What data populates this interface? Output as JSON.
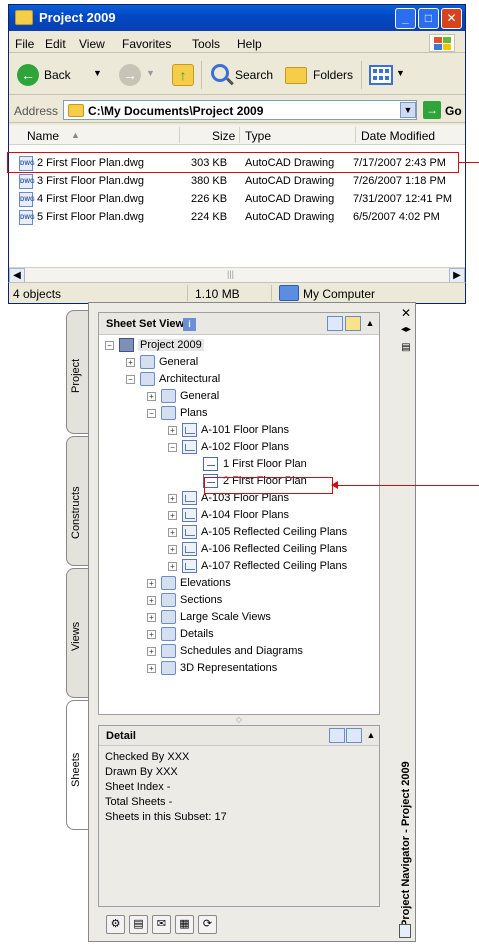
{
  "explorer": {
    "title": "Project 2009",
    "menu": [
      "File",
      "Edit",
      "View",
      "Favorites",
      "Tools",
      "Help"
    ],
    "toolbar": {
      "back_label": "Back",
      "search_label": "Search",
      "folders_label": "Folders"
    },
    "address": {
      "label": "Address",
      "path": "C:\\My Documents\\Project 2009",
      "go_label": "Go"
    },
    "columns": {
      "name": "Name",
      "size": "Size",
      "type": "Type",
      "date": "Date Modified"
    },
    "files": [
      {
        "name": "2 First Floor Plan.dwg",
        "size": "303 KB",
        "type": "AutoCAD Drawing",
        "date": "7/17/2007 2:43 PM"
      },
      {
        "name": "3 First Floor Plan.dwg",
        "size": "380 KB",
        "type": "AutoCAD Drawing",
        "date": "7/26/2007 1:18 PM"
      },
      {
        "name": "4 First Floor Plan.dwg",
        "size": "226 KB",
        "type": "AutoCAD Drawing",
        "date": "7/31/2007 12:41 PM"
      },
      {
        "name": "5 First Floor Plan.dwg",
        "size": "224 KB",
        "type": "AutoCAD Drawing",
        "date": "6/5/2007 4:02 PM"
      }
    ],
    "status": {
      "objects": "4 objects",
      "size": "1.10 MB",
      "location": "My Computer"
    }
  },
  "navigator": {
    "tabs": [
      "Project",
      "Constructs",
      "Views",
      "Sheets"
    ],
    "active_tab": "Sheets",
    "sheet_set_view": {
      "title": "Sheet Set View",
      "tree": [
        {
          "label": "Project 2009",
          "level": 0,
          "kind": "root",
          "expanded": true
        },
        {
          "label": "General",
          "level": 1,
          "kind": "subset",
          "expanded": false
        },
        {
          "label": "Architectural",
          "level": 1,
          "kind": "subset",
          "expanded": true
        },
        {
          "label": "General",
          "level": 2,
          "kind": "subset",
          "expanded": false
        },
        {
          "label": "Plans",
          "level": 2,
          "kind": "subset",
          "expanded": true
        },
        {
          "label": "A-101 Floor Plans",
          "level": 3,
          "kind": "sheet",
          "expanded": false
        },
        {
          "label": "A-102 Floor Plans",
          "level": 3,
          "kind": "sheet",
          "expanded": true
        },
        {
          "label": "1 First Floor Plan",
          "level": 4,
          "kind": "view"
        },
        {
          "label": "2 First Floor Plan",
          "level": 4,
          "kind": "view"
        },
        {
          "label": "A-103 Floor Plans",
          "level": 3,
          "kind": "sheet",
          "expanded": false
        },
        {
          "label": "A-104 Floor Plans",
          "level": 3,
          "kind": "sheet",
          "expanded": false
        },
        {
          "label": "A-105 Reflected Ceiling Plans",
          "level": 3,
          "kind": "sheet",
          "expanded": false
        },
        {
          "label": "A-106 Reflected Ceiling Plans",
          "level": 3,
          "kind": "sheet",
          "expanded": false
        },
        {
          "label": "A-107 Reflected Ceiling Plans",
          "level": 3,
          "kind": "sheet",
          "expanded": false
        },
        {
          "label": "Elevations",
          "level": 2,
          "kind": "subset",
          "expanded": false
        },
        {
          "label": "Sections",
          "level": 2,
          "kind": "subset",
          "expanded": false
        },
        {
          "label": "Large Scale Views",
          "level": 2,
          "kind": "subset",
          "expanded": false
        },
        {
          "label": "Details",
          "level": 2,
          "kind": "subset",
          "expanded": false
        },
        {
          "label": "Schedules and Diagrams",
          "level": 2,
          "kind": "subset",
          "expanded": false
        },
        {
          "label": "3D Representations",
          "level": 2,
          "kind": "subset",
          "expanded": false
        }
      ]
    },
    "detail": {
      "title": "Detail",
      "lines": [
        "Checked By XXX",
        "Drawn By XXX",
        "Sheet Index -",
        "Total Sheets -",
        "Sheets in this Subset: 17"
      ]
    },
    "side_title": "Project Navigator - Project 2009",
    "colors": {
      "highlight": "#d01010",
      "title_bar": "#0a5fd8"
    }
  }
}
